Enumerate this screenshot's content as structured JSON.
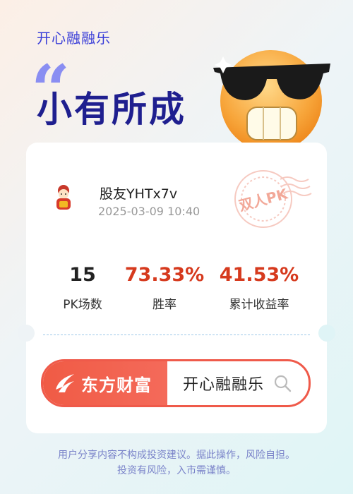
{
  "header": {
    "app_name": "开心融融乐",
    "quote_mark": "“",
    "slogan": "小有所成"
  },
  "card": {
    "user": {
      "name": "股友YHTx7v",
      "datetime": "2025-03-09 10:40"
    },
    "stamp_text": "双人PK",
    "stats": [
      {
        "value": "15",
        "label": "PK场数"
      },
      {
        "value": "73.33%",
        "label": "胜率"
      },
      {
        "value": "41.53%",
        "label": "累计收益率"
      }
    ],
    "brand": {
      "name": "东方财富",
      "search_text": "开心融融乐"
    }
  },
  "footer": {
    "line1": "用户分享内容不构成投资建议。据此操作，风险自担。",
    "line2": "投资有风险，入市需谨慎。"
  },
  "colors": {
    "accent_blue": "#3b3fd8",
    "stat_red": "#d63a1e",
    "brand_red": "#ef5a4a"
  },
  "icons": {
    "emoji": "cool-sunglasses-emoji",
    "avatar": "fortune-god-avatar",
    "stamp": "postmark-stamp",
    "brand_logo": "eastmoney-logo",
    "search": "search-icon"
  }
}
